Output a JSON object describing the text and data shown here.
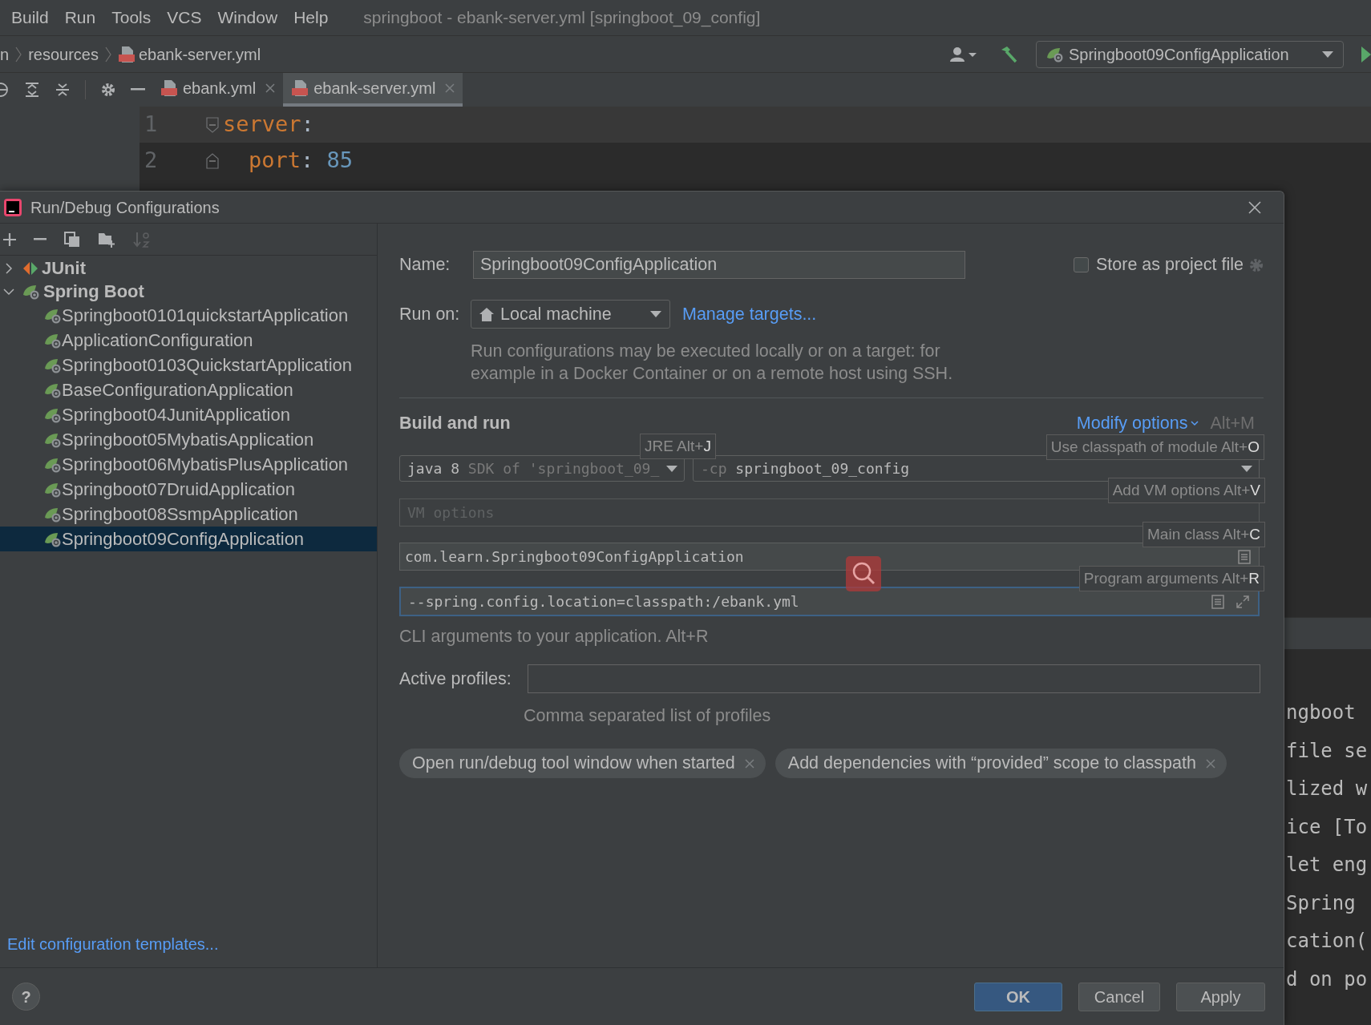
{
  "menu_bar": {
    "items": [
      "Build",
      "Run",
      "Tools",
      "VCS",
      "Window",
      "Help"
    ],
    "title": "springboot - ebank-server.yml [springboot_09_config]"
  },
  "breadcrumb": [
    "n",
    "resources",
    "ebank-server.yml"
  ],
  "run_config": {
    "label": "Springboot09ConfigApplication"
  },
  "editor_tabs": [
    {
      "label": "ebank.yml",
      "selected": false
    },
    {
      "label": "ebank-server.yml",
      "selected": true
    }
  ],
  "editor": {
    "lines": [
      {
        "number": "1",
        "key": "server",
        "colon": ":",
        "current": true,
        "children": [
          {
            "number": "2",
            "key": "port",
            "colon": ":",
            "value": "85",
            "current": false
          }
        ]
      }
    ]
  },
  "console": {
    "lines": [
      "ngboot",
      "file se",
      "lized w",
      "ice [To",
      "let eng",
      "Spring",
      "cation(",
      "d on po"
    ]
  },
  "dialog": {
    "title": "Run/Debug Configurations",
    "tree": [
      {
        "label": "JUnit",
        "kind": "junit",
        "expanded": false,
        "selected": false
      },
      {
        "label": "Spring Boot",
        "kind": "spring",
        "expanded": true,
        "selected": false,
        "children": [
          {
            "label": "Springboot0101quickstartApplication",
            "selected": false
          },
          {
            "label": "ApplicationConfiguration",
            "selected": false
          },
          {
            "label": "Springboot0103QuickstartApplication",
            "selected": false
          },
          {
            "label": "BaseConfigurationApplication",
            "selected": false
          },
          {
            "label": "Springboot04JunitApplication",
            "selected": false
          },
          {
            "label": "Springboot05MybatisApplication",
            "selected": false
          },
          {
            "label": "Springboot06MybatisPlusApplication",
            "selected": false
          },
          {
            "label": "Springboot07DruidApplication",
            "selected": false
          },
          {
            "label": "Springboot08SsmpApplication",
            "selected": false
          },
          {
            "label": "Springboot09ConfigApplication",
            "selected": true
          }
        ]
      }
    ],
    "templates_link": "Edit configuration templates...",
    "form": {
      "name_label": "Name:",
      "name_value": "Springboot09ConfigApplication",
      "store_checkbox": {
        "label": "Store as project file",
        "checked": false
      },
      "run_on_label": "Run on:",
      "run_on_value": "Local machine",
      "manage_link": "Manage targets...",
      "description": "Run configurations may be executed locally or on a target: for\nexample in a Docker Container or on a remote host using SSH.",
      "section_title": "Build and run",
      "modify_options": {
        "label": "Modify options",
        "shortcut": "Alt+M"
      },
      "jre": {
        "value": "java 8",
        "hint": "SDK of 'springboot_09_"
      },
      "classpath": {
        "prefix": "-cp",
        "value": "springboot_09_config"
      },
      "vm_options": {
        "placeholder": "VM options"
      },
      "main_class": {
        "value": "com.learn.Springboot09ConfigApplication"
      },
      "program_args": {
        "value": "--spring.config.location=classpath:/ebank.yml",
        "focused": true
      },
      "cli_hint": "CLI arguments to your application. Alt+R",
      "active_profiles_label": "Active profiles:",
      "profiles_hint": "Comma separated list of profiles",
      "chips": [
        "Open run/debug tool window when started",
        "Add dependencies with “provided” scope to classpath"
      ],
      "tooltips": [
        {
          "label": "JRE Alt+",
          "key": "J"
        },
        {
          "label": "Use classpath of module Alt+",
          "key": "O"
        },
        {
          "label": "Add VM options Alt+",
          "key": "V"
        },
        {
          "label": "Main class Alt+",
          "key": "C"
        },
        {
          "label": "Program arguments Alt+",
          "key": "R"
        }
      ]
    },
    "buttons": [
      {
        "label": "OK",
        "kind": "primary"
      },
      {
        "label": "Cancel",
        "kind": "normal"
      },
      {
        "label": "Apply",
        "kind": "normal"
      }
    ],
    "help": "?"
  }
}
